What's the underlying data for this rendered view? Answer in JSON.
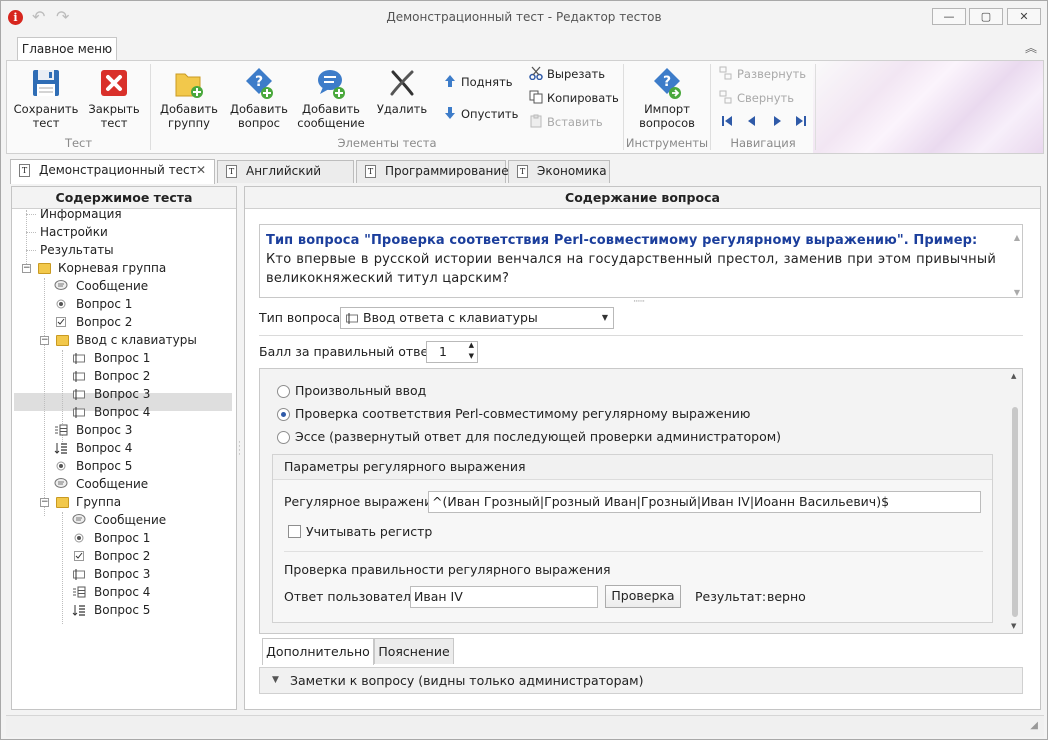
{
  "window": {
    "title": "Демонстрационный тест - Редактор тестов",
    "minimize": "—",
    "maximize": "▢",
    "close": "✕"
  },
  "ribbon": {
    "main_tab": "Главное меню",
    "groups": {
      "test": "Тест",
      "elements": "Элементы теста",
      "tools": "Инструменты",
      "navigation": "Навигация"
    },
    "buttons": {
      "save": [
        "Сохранить",
        "тест"
      ],
      "close_test": [
        "Закрыть",
        "тест"
      ],
      "add_group": [
        "Добавить",
        "группу"
      ],
      "add_question": [
        "Добавить",
        "вопрос"
      ],
      "add_message": [
        "Добавить",
        "сообщение"
      ],
      "delete": "Удалить",
      "move_up": "Поднять",
      "move_down": "Опустить",
      "cut": "Вырезать",
      "copy": "Копировать",
      "paste": "Вставить",
      "import": [
        "Импорт",
        "вопросов"
      ],
      "expand": "Развернуть",
      "collapse": "Свернуть"
    }
  },
  "doc_tabs": [
    {
      "label": "Демонстрационный тест",
      "active": true
    },
    {
      "label": "Английский язык"
    },
    {
      "label": "Программирование"
    },
    {
      "label": "Экономика"
    }
  ],
  "tree": {
    "header": "Содержимое теста",
    "nodes": [
      {
        "label": "Информация"
      },
      {
        "label": "Настройки"
      },
      {
        "label": "Результаты"
      },
      {
        "label": "Корневая группа"
      },
      {
        "label": "Сообщение"
      },
      {
        "label": "Вопрос 1"
      },
      {
        "label": "Вопрос 2"
      },
      {
        "label": "Ввод с клавиатуры"
      },
      {
        "label": "Вопрос 1"
      },
      {
        "label": "Вопрос 2"
      },
      {
        "label": "Вопрос 3",
        "selected": true
      },
      {
        "label": "Вопрос 4"
      },
      {
        "label": "Вопрос 3"
      },
      {
        "label": "Вопрос 4"
      },
      {
        "label": "Вопрос 5"
      },
      {
        "label": "Сообщение"
      },
      {
        "label": "Группа"
      },
      {
        "label": "Сообщение"
      },
      {
        "label": "Вопрос 1"
      },
      {
        "label": "Вопрос 2"
      },
      {
        "label": "Вопрос 3"
      },
      {
        "label": "Вопрос 4"
      },
      {
        "label": "Вопрос 5"
      }
    ]
  },
  "question": {
    "header": "Содержание вопроса",
    "title": "Тип вопроса \"Проверка соответствия Perl-совместимому регулярному выражению\". Пример:",
    "text": "Кто впервые в русской истории венчался на государственный престол, заменив при этом привычный великокняжеский титул царским?",
    "type_label": "Тип вопроса",
    "type_value": "Ввод ответа с клавиатуры",
    "score_label": "Балл за правильный ответ",
    "score_value": "1",
    "options": [
      {
        "label": "Произвольный ввод",
        "selected": false
      },
      {
        "label": "Проверка соответствия Perl-совместимому регулярному выражению",
        "selected": true
      },
      {
        "label": "Эссе (развернутый ответ для последующей проверки администратором)",
        "selected": false
      }
    ],
    "regex_section": {
      "title": "Параметры регулярного выражения",
      "regex_label": "Регулярное выражение",
      "regex_value": "^(Иван Грозный|Грозный Иван|Грозный|Иван IV|Иоанн Васильевич)$",
      "case_label": "Учитывать регистр",
      "case_checked": false,
      "check_title": "Проверка правильности регулярного выражения",
      "user_answer_label": "Ответ пользователя",
      "user_answer_value": "Иван IV",
      "check_button": "Проверка",
      "result_label": "Результат:",
      "result_value": "верно"
    },
    "bottom_tabs": [
      {
        "label": "Дополнительно",
        "active": true
      },
      {
        "label": "Пояснение"
      }
    ],
    "notes_label": "Заметки к вопросу (видны только администраторам)"
  }
}
